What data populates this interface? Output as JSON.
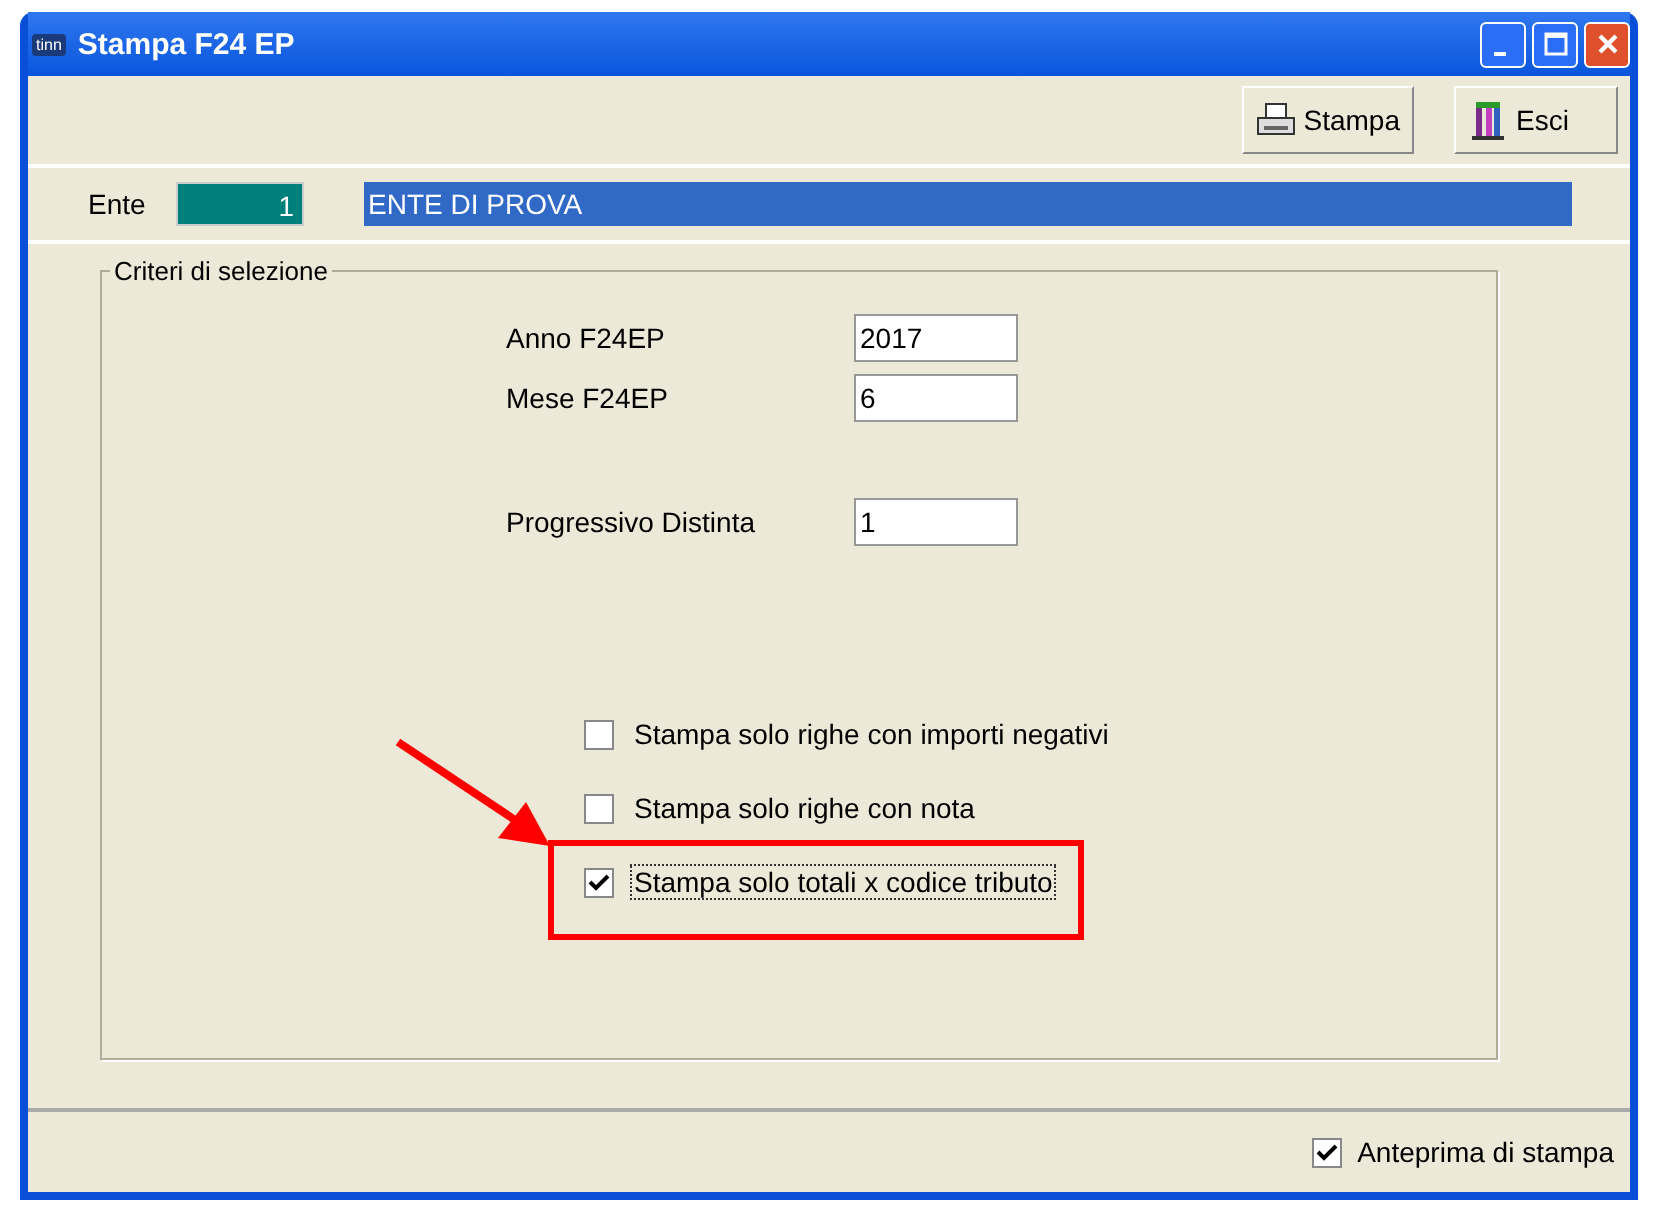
{
  "window": {
    "app_badge": "tinn",
    "title": "Stampa F24 EP"
  },
  "toolbar": {
    "buttons": [
      {
        "kind": "print",
        "label": "Stampa"
      },
      {
        "kind": "exit",
        "label": "Esci"
      }
    ]
  },
  "ente": {
    "label": "Ente",
    "code": "1",
    "name": "ENTE DI PROVA"
  },
  "criteria": {
    "title": "Criteri di selezione",
    "fields": [
      {
        "label": "Anno F24EP",
        "value": "2017"
      },
      {
        "label": "Mese F24EP",
        "value": "6"
      },
      {
        "label": "Progressivo Distinta",
        "value": "1"
      }
    ],
    "options": [
      {
        "label": "Stampa solo righe con importi negativi",
        "checked": false,
        "focused": false
      },
      {
        "label": "Stampa solo righe con nota",
        "checked": false,
        "focused": false
      },
      {
        "label": "Stampa solo totali x codice tributo",
        "checked": true,
        "focused": true
      }
    ]
  },
  "footer": {
    "preview": {
      "label": "Anteprima di stampa",
      "checked": true
    }
  }
}
